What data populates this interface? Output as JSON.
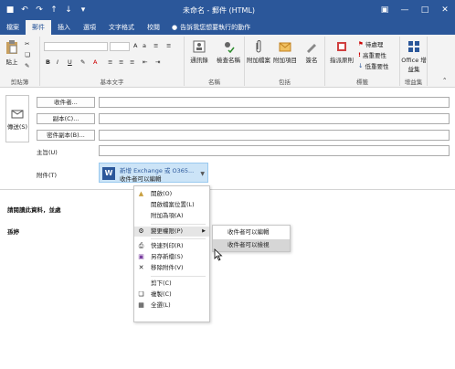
{
  "window": {
    "title": "未命名 - 郵件 (HTML)",
    "title_bar_color": "#2b579a"
  },
  "tabs": [
    {
      "label": "檔案"
    },
    {
      "label": "郵件"
    },
    {
      "label": "插入"
    },
    {
      "label": "選項"
    },
    {
      "label": "文字格式"
    },
    {
      "label": "校閱"
    }
  ],
  "tell_me": "告訴我您想要執行的動作",
  "ribbon": {
    "clipboard": {
      "label": "剪貼簿",
      "paste": "貼上"
    },
    "basic_text": {
      "label": "基本文字",
      "bold": "B",
      "italic": "I",
      "underline": "U"
    },
    "names": {
      "label": "名稱",
      "address_book": "通訊錄",
      "check_names": "檢查名稱"
    },
    "include": {
      "label": "包括",
      "attach_file": "附加檔案",
      "attach_item": "附加項目",
      "signature": "簽名"
    },
    "tags": {
      "label": "標籤",
      "follow_up": "待處理",
      "high_importance": "高重要性",
      "low_importance": "低重要性",
      "assign_policy": "指派原則"
    },
    "addins": {
      "label": "增益集",
      "office_addins": "Office 增益集"
    }
  },
  "header": {
    "send": "傳送(S)",
    "to_button": "收件者...",
    "cc_button": "副本(C)...",
    "bcc_button": "密件副本(B)...",
    "subject_label": "主旨(U)",
    "attached_label": "附件(T)"
  },
  "attachment": {
    "name": "新增 Exchange 或 O365...",
    "sub": "收件者可以編輯"
  },
  "body": {
    "line1": "請閱讀此資料，並處",
    "line2": "孫婷"
  },
  "context_menu": {
    "items": [
      {
        "label": "開啟(O)",
        "icon": "open-icon"
      },
      {
        "label": "開啟檔案位置(L)",
        "icon": "none"
      },
      {
        "label": "附加為項(A)",
        "icon": "none"
      },
      {
        "label": "變更權限(P)",
        "icon": "permission-icon",
        "submenu": true
      },
      {
        "label": "快速列印(R)",
        "icon": "print-icon"
      },
      {
        "label": "另存新檔(S)",
        "icon": "save-icon"
      },
      {
        "label": "移除附件(V)",
        "icon": "remove-icon"
      },
      {
        "label": "剪下(C)",
        "icon": "none"
      },
      {
        "label": "複製(C)",
        "icon": "copy-icon"
      },
      {
        "label": "全選(L)",
        "icon": "select-all-icon"
      }
    ]
  },
  "submenu": {
    "items": [
      {
        "label": "收件者可以編輯"
      },
      {
        "label": "收件者可以檢視"
      }
    ]
  }
}
